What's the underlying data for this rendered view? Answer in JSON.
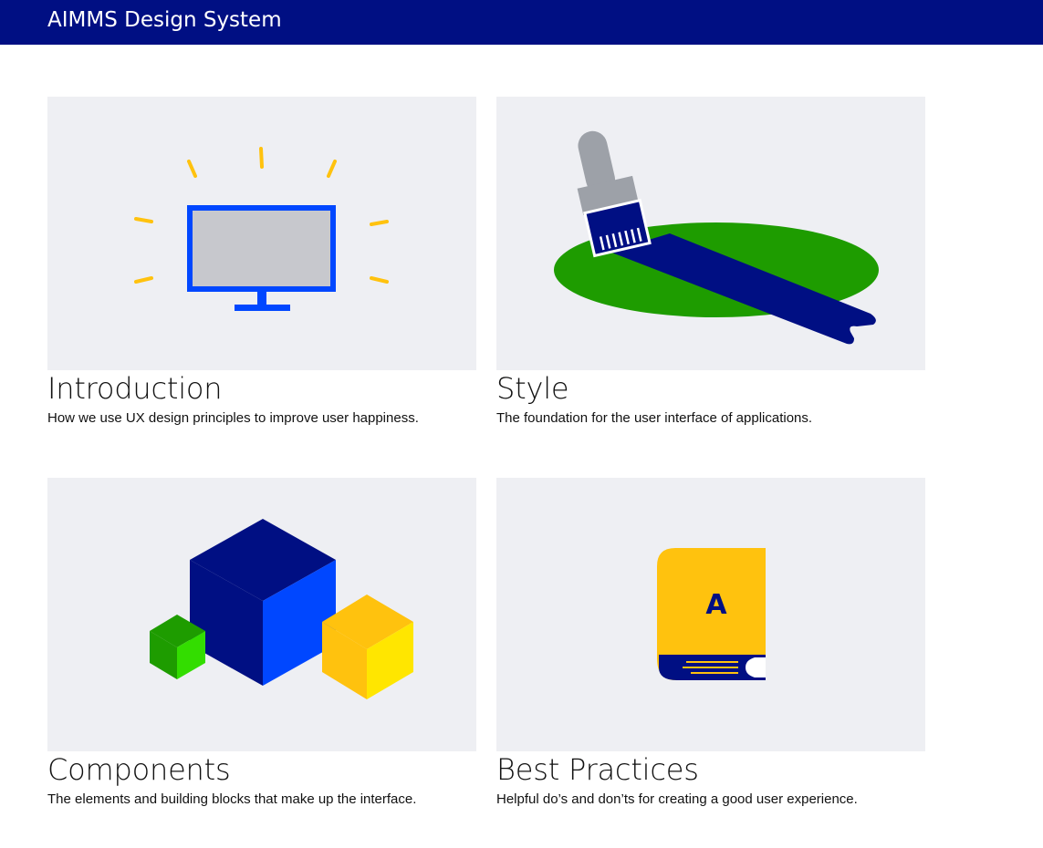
{
  "header": {
    "title": "AIMMS Design System",
    "background": "#000f83"
  },
  "cards": [
    {
      "title": "Introduction",
      "description": "How we use UX design principles to improve user happiness.",
      "illustration": "monitor-icon"
    },
    {
      "title": "Style",
      "description": "The foundation for the user interface of applications.",
      "illustration": "paintbrush-icon"
    },
    {
      "title": "Components",
      "description": "The elements and building blocks that make up the interface.",
      "illustration": "cubes-icon"
    },
    {
      "title": "Best Practices",
      "description": "Helpful do’s and don’ts for creating a good user experience.",
      "illustration": "book-icon",
      "book_letter": "A"
    }
  ],
  "colors": {
    "navy": "#000f83",
    "blue": "#0047ff",
    "yellow": "#ffc20e",
    "green": "#1e9c00",
    "thumb_bg": "#eeeff3"
  }
}
